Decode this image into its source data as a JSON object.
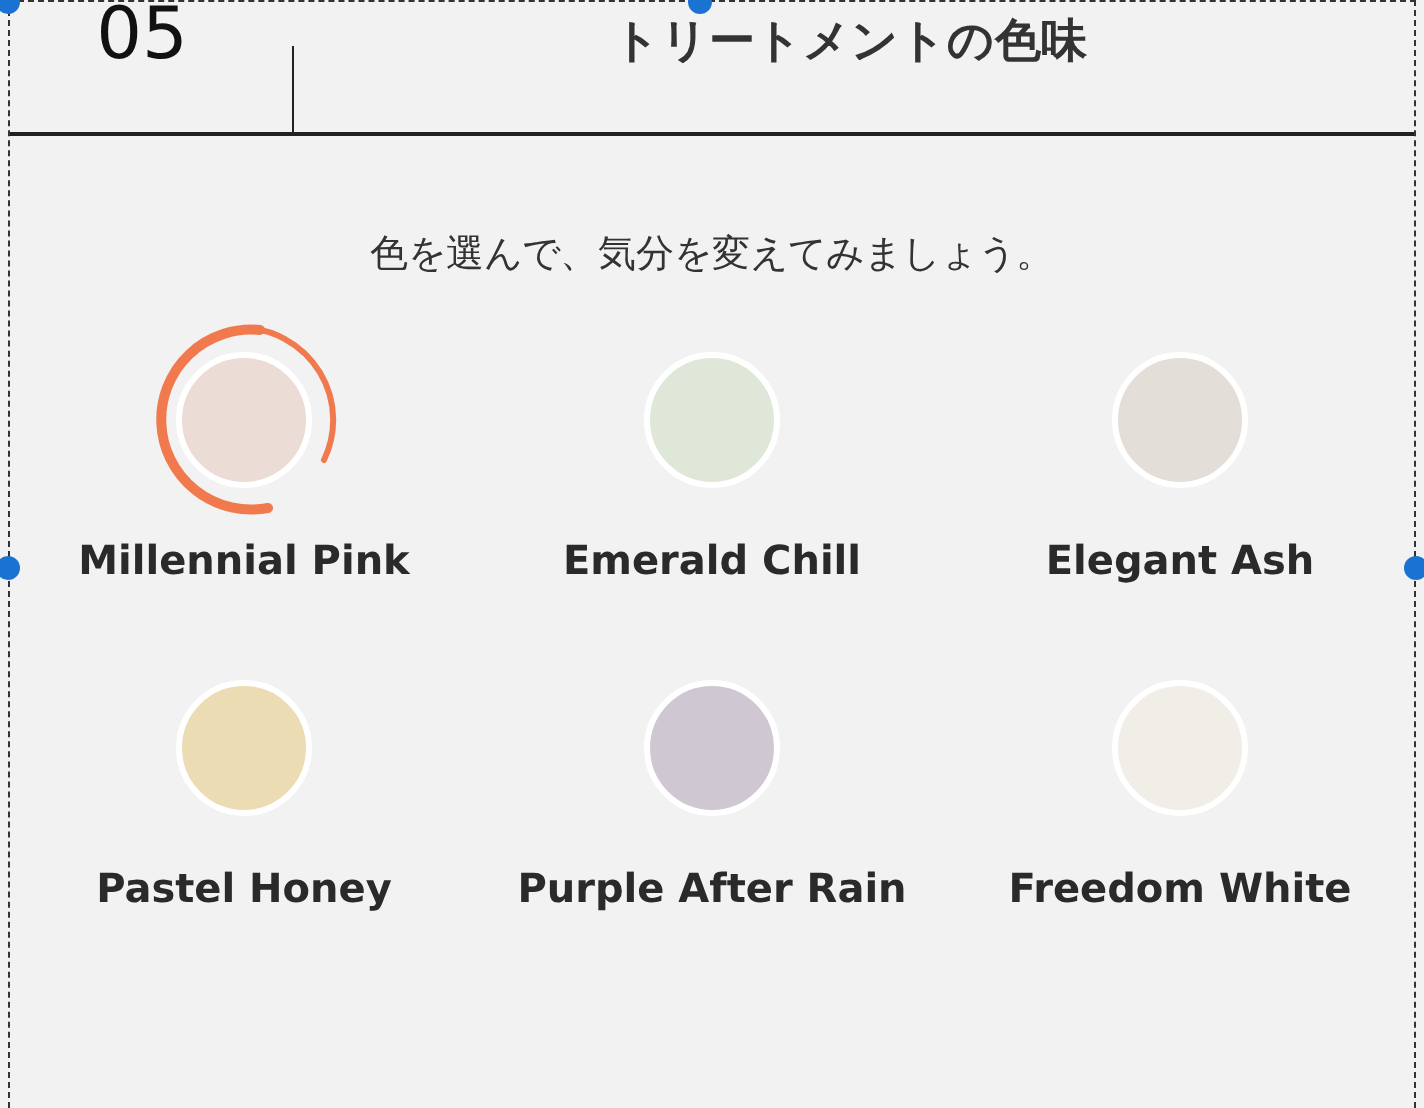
{
  "section": {
    "number": "05",
    "title": "トリートメントの色味"
  },
  "prompt": "色を選んで、気分を変えてみましょう。",
  "colors": [
    {
      "name": "Millennial Pink",
      "color": "#ecdcd6",
      "selected": true
    },
    {
      "name": "Emerald Chill",
      "color": "#dfe8d8",
      "selected": false
    },
    {
      "name": "Elegant Ash",
      "color": "#e4ded9",
      "selected": false
    },
    {
      "name": "Pastel Honey",
      "color": "#ecdcb4",
      "selected": false
    },
    {
      "name": "Purple After Rain",
      "color": "#cfc8d2",
      "selected": false
    },
    {
      "name": "Freedom White",
      "color": "#f1eee7",
      "selected": false
    }
  ]
}
